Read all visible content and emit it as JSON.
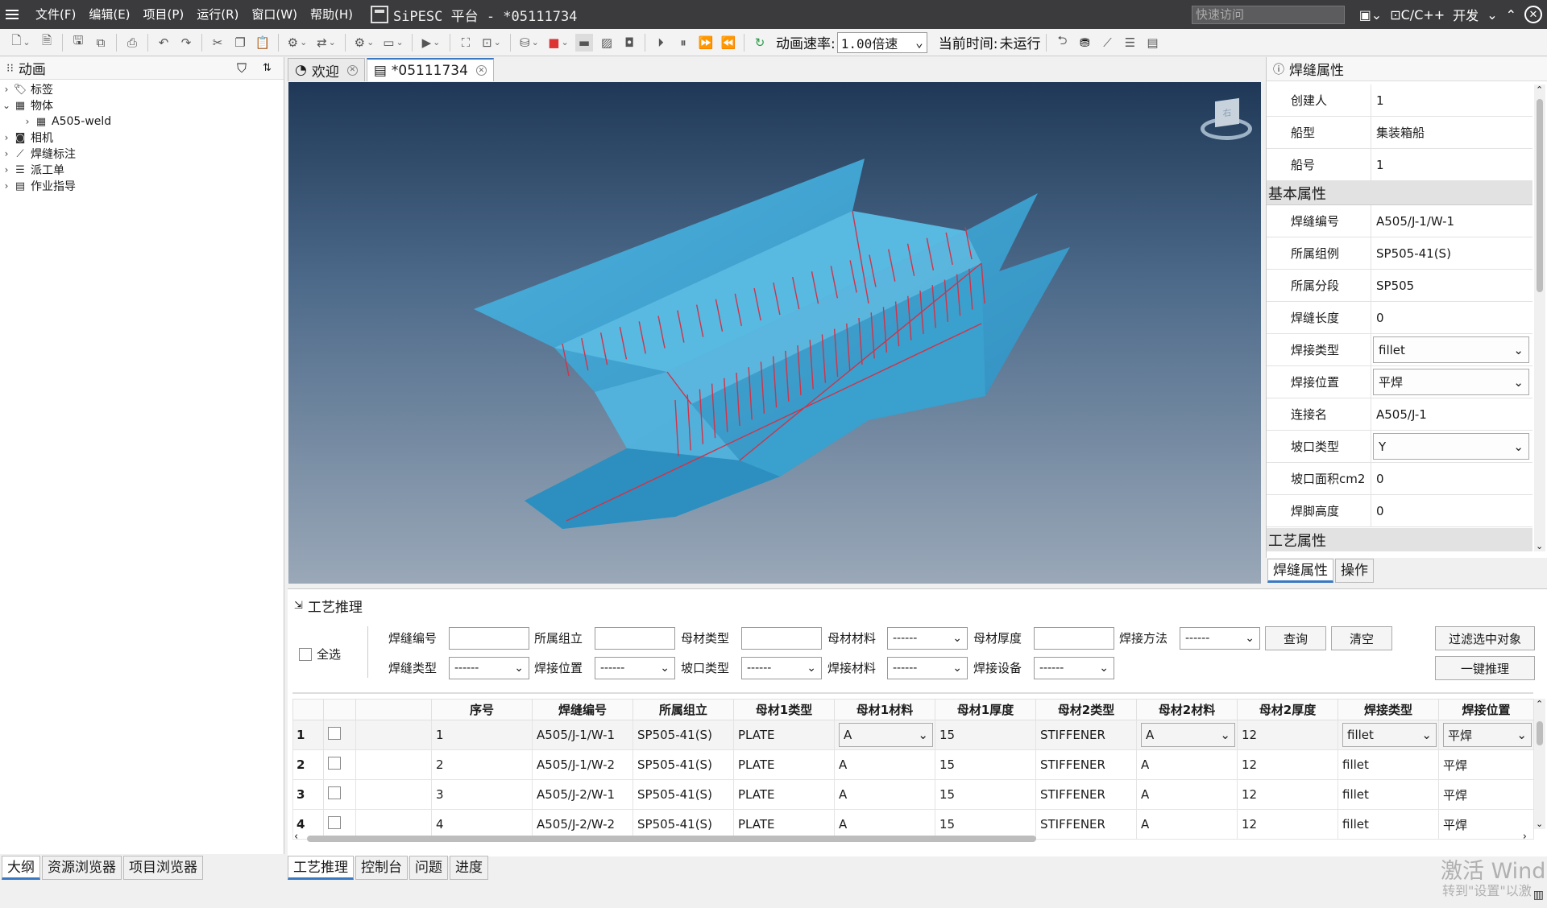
{
  "titlebar": {
    "menu": [
      "文件(F)",
      "编辑(E)",
      "项目(P)",
      "运行(R)",
      "窗口(W)",
      "帮助(H)"
    ],
    "title": "SiPESC 平台 - *05111734",
    "quick_access_placeholder": "快速访问",
    "language": "C/C++",
    "mode": "开发"
  },
  "toolbar": {
    "speed_label": "动画速率:",
    "speed_value": "1.00倍速",
    "time_label": "当前时间:",
    "time_value": "未运行"
  },
  "left_panel": {
    "title": "动画",
    "tree": [
      {
        "label": "标签",
        "expanded": false
      },
      {
        "label": "物体",
        "expanded": true,
        "children": [
          {
            "label": "A505-weld"
          }
        ]
      },
      {
        "label": "相机",
        "expanded": false
      },
      {
        "label": "焊缝标注",
        "expanded": false
      },
      {
        "label": "派工单",
        "expanded": false
      },
      {
        "label": "作业指导",
        "expanded": false
      }
    ],
    "tabs": [
      "大纲",
      "资源浏览器",
      "项目浏览器"
    ]
  },
  "editor": {
    "tabs": [
      {
        "label": "欢迎"
      },
      {
        "label": "*05111734"
      }
    ],
    "viewcube_label": "右"
  },
  "properties": {
    "title": "焊缝属性",
    "rows_top": [
      {
        "key": "创建人",
        "value": "1"
      },
      {
        "key": "船型",
        "value": "集装箱船"
      },
      {
        "key": "船号",
        "value": "1"
      }
    ],
    "group_basic": "基本属性",
    "rows_basic": [
      {
        "key": "焊缝编号",
        "value": "A505/J-1/W-1"
      },
      {
        "key": "所属组例",
        "value": "SP505-41(S)"
      },
      {
        "key": "所属分段",
        "value": "SP505"
      },
      {
        "key": "焊缝长度",
        "value": "0"
      },
      {
        "key": "焊接类型",
        "value": "fillet",
        "select": true
      },
      {
        "key": "焊接位置",
        "value": "平焊",
        "select": true
      },
      {
        "key": "连接名",
        "value": "A505/J-1"
      },
      {
        "key": "坡口类型",
        "value": "Y",
        "select": true
      },
      {
        "key": "坡口面积cm2",
        "value": "0"
      },
      {
        "key": "焊脚高度",
        "value": "0"
      }
    ],
    "group_process": "工艺属性",
    "tabs": [
      "焊缝属性",
      "操作"
    ]
  },
  "process": {
    "title": "工艺推理",
    "select_all": "全选",
    "filters": {
      "weld_no": "焊缝编号",
      "assembly": "所属组立",
      "base_type": "母材类型",
      "base_material": "母材材料",
      "base_thickness": "母材厚度",
      "weld_method": "焊接方法",
      "weld_type": "焊缝类型",
      "weld_position": "焊接位置",
      "groove_type": "坡口类型",
      "weld_material": "焊接材料",
      "weld_equipment": "焊接设备",
      "empty_option": "------"
    },
    "buttons": {
      "query": "查询",
      "clear": "清空",
      "filter_selected": "过滤选中对象",
      "infer_all": "一键推理"
    },
    "columns": [
      "序号",
      "焊缝编号",
      "所属组立",
      "母材1类型",
      "母材1材料",
      "母材1厚度",
      "母材2类型",
      "母材2材料",
      "母材2厚度",
      "焊接类型",
      "焊接位置"
    ],
    "rows": [
      {
        "rn": "1",
        "cells": [
          "1",
          "A505/J-1/W-1",
          "SP505-41(S)",
          "PLATE",
          "A",
          "15",
          "STIFFENER",
          "A",
          "12",
          "fillet",
          "平焊"
        ]
      },
      {
        "rn": "2",
        "cells": [
          "2",
          "A505/J-1/W-2",
          "SP505-41(S)",
          "PLATE",
          "A",
          "15",
          "STIFFENER",
          "A",
          "12",
          "fillet",
          "平焊"
        ]
      },
      {
        "rn": "3",
        "cells": [
          "3",
          "A505/J-2/W-1",
          "SP505-41(S)",
          "PLATE",
          "A",
          "15",
          "STIFFENER",
          "A",
          "12",
          "fillet",
          "平焊"
        ]
      },
      {
        "rn": "4",
        "cells": [
          "4",
          "A505/J-2/W-2",
          "SP505-41(S)",
          "PLATE",
          "A",
          "15",
          "STIFFENER",
          "A",
          "12",
          "fillet",
          "平焊"
        ]
      }
    ],
    "tabs": [
      "工艺推理",
      "控制台",
      "问题",
      "进度"
    ]
  },
  "watermark": {
    "line1": "激活 Windo",
    "line2": "转到\"设置\"以激"
  },
  "colors": {
    "hull": "#3b9fce",
    "weld_line": "#d0334a",
    "titlebar": "#3b3b3d",
    "accent": "#3a78c2"
  }
}
